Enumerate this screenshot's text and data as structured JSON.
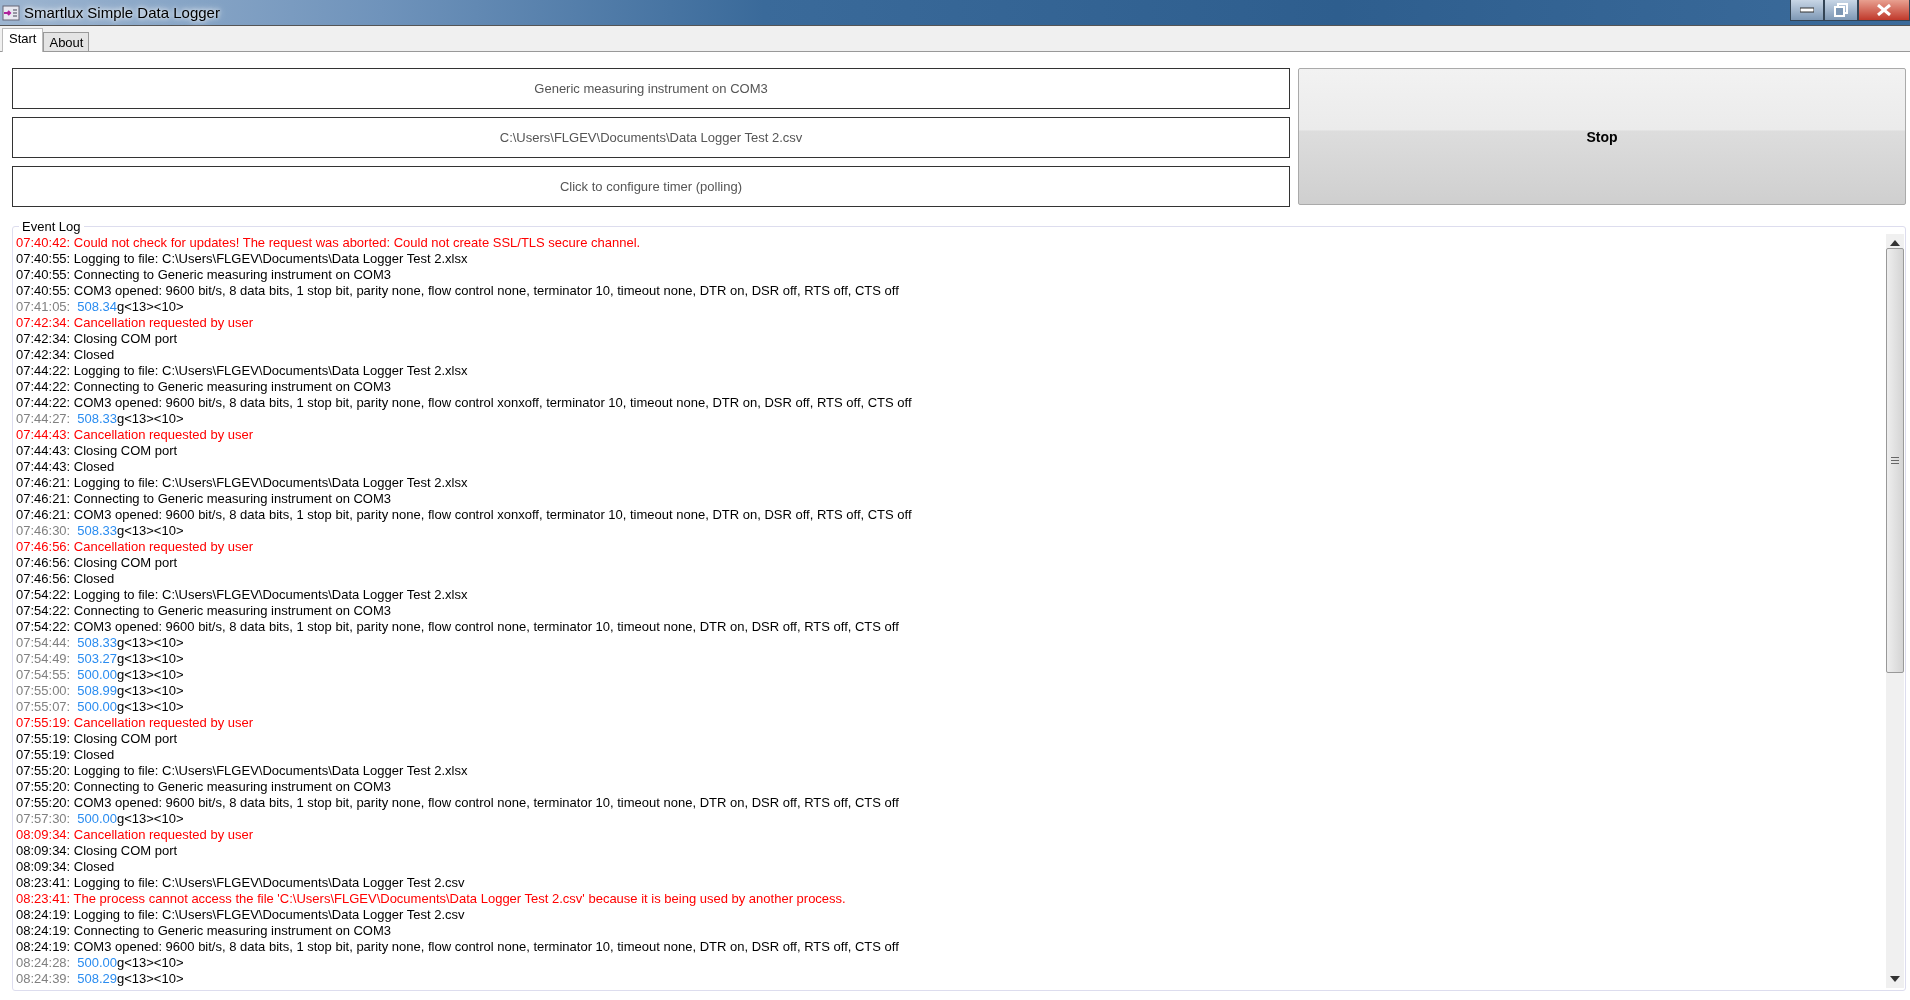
{
  "window": {
    "title": "Smartlux Simple Data Logger"
  },
  "tabs": [
    {
      "label": "Start",
      "selected": true
    },
    {
      "label": "About",
      "selected": false
    }
  ],
  "buttons": {
    "device": "Generic measuring instrument on COM3",
    "file": "C:\\Users\\FLGEV\\Documents\\Data Logger Test 2.csv",
    "timer": "Click to configure timer (polling)",
    "stop": "Stop"
  },
  "event_log": {
    "title": "Event Log",
    "lines": [
      {
        "kind": "error",
        "text": "07:40:42: Could not check for updates! The request was aborted: Could not create SSL/TLS secure channel."
      },
      {
        "kind": "info",
        "text": "07:40:55: Logging to file: C:\\Users\\FLGEV\\Documents\\Data Logger Test 2.xlsx"
      },
      {
        "kind": "info",
        "text": "07:40:55: Connecting to Generic measuring instrument on COM3"
      },
      {
        "kind": "info",
        "text": "07:40:55: COM3 opened: 9600 bit/s, 8 data bits, 1 stop bit, parity none, flow control none, terminator 10, timeout none, DTR on, DSR off, RTS off, CTS off"
      },
      {
        "kind": "reading",
        "time": "07:41:05:",
        "value": "508.34",
        "suffix": "g<13><10>"
      },
      {
        "kind": "error",
        "text": "07:42:34: Cancellation requested by user"
      },
      {
        "kind": "info",
        "text": "07:42:34: Closing COM port"
      },
      {
        "kind": "info",
        "text": "07:42:34: Closed"
      },
      {
        "kind": "info",
        "text": "07:44:22: Logging to file: C:\\Users\\FLGEV\\Documents\\Data Logger Test 2.xlsx"
      },
      {
        "kind": "info",
        "text": "07:44:22: Connecting to Generic measuring instrument on COM3"
      },
      {
        "kind": "info",
        "text": "07:44:22: COM3 opened: 9600 bit/s, 8 data bits, 1 stop bit, parity none, flow control xonxoff, terminator 10, timeout none, DTR on, DSR off, RTS off, CTS off"
      },
      {
        "kind": "reading",
        "time": "07:44:27:",
        "value": "508.33",
        "suffix": "g<13><10>"
      },
      {
        "kind": "error",
        "text": "07:44:43: Cancellation requested by user"
      },
      {
        "kind": "info",
        "text": "07:44:43: Closing COM port"
      },
      {
        "kind": "info",
        "text": "07:44:43: Closed"
      },
      {
        "kind": "info",
        "text": "07:46:21: Logging to file: C:\\Users\\FLGEV\\Documents\\Data Logger Test 2.xlsx"
      },
      {
        "kind": "info",
        "text": "07:46:21: Connecting to Generic measuring instrument on COM3"
      },
      {
        "kind": "info",
        "text": "07:46:21: COM3 opened: 9600 bit/s, 8 data bits, 1 stop bit, parity none, flow control xonxoff, terminator 10, timeout none, DTR on, DSR off, RTS off, CTS off"
      },
      {
        "kind": "reading",
        "time": "07:46:30:",
        "value": "508.33",
        "suffix": "g<13><10>"
      },
      {
        "kind": "error",
        "text": "07:46:56: Cancellation requested by user"
      },
      {
        "kind": "info",
        "text": "07:46:56: Closing COM port"
      },
      {
        "kind": "info",
        "text": "07:46:56: Closed"
      },
      {
        "kind": "info",
        "text": "07:54:22: Logging to file: C:\\Users\\FLGEV\\Documents\\Data Logger Test 2.xlsx"
      },
      {
        "kind": "info",
        "text": "07:54:22: Connecting to Generic measuring instrument on COM3"
      },
      {
        "kind": "info",
        "text": "07:54:22: COM3 opened: 9600 bit/s, 8 data bits, 1 stop bit, parity none, flow control none, terminator 10, timeout none, DTR on, DSR off, RTS off, CTS off"
      },
      {
        "kind": "reading",
        "time": "07:54:44:",
        "value": "508.33",
        "suffix": "g<13><10>"
      },
      {
        "kind": "reading",
        "time": "07:54:49:",
        "value": "503.27",
        "suffix": "g<13><10>"
      },
      {
        "kind": "reading",
        "time": "07:54:55:",
        "value": "500.00",
        "suffix": "g<13><10>"
      },
      {
        "kind": "reading",
        "time": "07:55:00:",
        "value": "508.99",
        "suffix": "g<13><10>"
      },
      {
        "kind": "reading",
        "time": "07:55:07:",
        "value": "500.00",
        "suffix": "g<13><10>"
      },
      {
        "kind": "error",
        "text": "07:55:19: Cancellation requested by user"
      },
      {
        "kind": "info",
        "text": "07:55:19: Closing COM port"
      },
      {
        "kind": "info",
        "text": "07:55:19: Closed"
      },
      {
        "kind": "info",
        "text": "07:55:20: Logging to file: C:\\Users\\FLGEV\\Documents\\Data Logger Test 2.xlsx"
      },
      {
        "kind": "info",
        "text": "07:55:20: Connecting to Generic measuring instrument on COM3"
      },
      {
        "kind": "info",
        "text": "07:55:20: COM3 opened: 9600 bit/s, 8 data bits, 1 stop bit, parity none, flow control none, terminator 10, timeout none, DTR on, DSR off, RTS off, CTS off"
      },
      {
        "kind": "reading",
        "time": "07:57:30:",
        "value": "500.00",
        "suffix": "g<13><10>"
      },
      {
        "kind": "error",
        "text": "08:09:34: Cancellation requested by user"
      },
      {
        "kind": "info",
        "text": "08:09:34: Closing COM port"
      },
      {
        "kind": "info",
        "text": "08:09:34: Closed"
      },
      {
        "kind": "info",
        "text": "08:23:41: Logging to file: C:\\Users\\FLGEV\\Documents\\Data Logger Test 2.csv"
      },
      {
        "kind": "error",
        "text": "08:23:41: The process cannot access the file 'C:\\Users\\FLGEV\\Documents\\Data Logger Test 2.csv' because it is being used by another process."
      },
      {
        "kind": "info",
        "text": "08:24:19: Logging to file: C:\\Users\\FLGEV\\Documents\\Data Logger Test 2.csv"
      },
      {
        "kind": "info",
        "text": "08:24:19: Connecting to Generic measuring instrument on COM3"
      },
      {
        "kind": "info",
        "text": "08:24:19: COM3 opened: 9600 bit/s, 8 data bits, 1 stop bit, parity none, flow control none, terminator 10, timeout none, DTR on, DSR off, RTS off, CTS off"
      },
      {
        "kind": "reading",
        "time": "08:24:28:",
        "value": "500.00",
        "suffix": "g<13><10>"
      },
      {
        "kind": "reading",
        "time": "08:24:39:",
        "value": "508.29",
        "suffix": "g<13><10>"
      }
    ]
  }
}
